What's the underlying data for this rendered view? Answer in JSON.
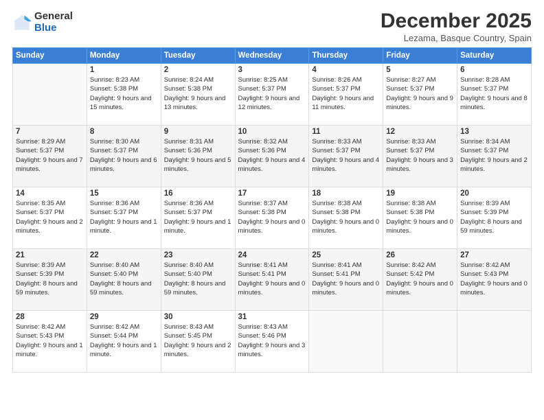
{
  "logo": {
    "general": "General",
    "blue": "Blue"
  },
  "title": "December 2025",
  "location": "Lezama, Basque Country, Spain",
  "weekdays": [
    "Sunday",
    "Monday",
    "Tuesday",
    "Wednesday",
    "Thursday",
    "Friday",
    "Saturday"
  ],
  "weeks": [
    [
      {
        "day": null,
        "sunrise": null,
        "sunset": null,
        "daylight": null
      },
      {
        "day": "1",
        "sunrise": "Sunrise: 8:23 AM",
        "sunset": "Sunset: 5:38 PM",
        "daylight": "Daylight: 9 hours and 15 minutes."
      },
      {
        "day": "2",
        "sunrise": "Sunrise: 8:24 AM",
        "sunset": "Sunset: 5:38 PM",
        "daylight": "Daylight: 9 hours and 13 minutes."
      },
      {
        "day": "3",
        "sunrise": "Sunrise: 8:25 AM",
        "sunset": "Sunset: 5:37 PM",
        "daylight": "Daylight: 9 hours and 12 minutes."
      },
      {
        "day": "4",
        "sunrise": "Sunrise: 8:26 AM",
        "sunset": "Sunset: 5:37 PM",
        "daylight": "Daylight: 9 hours and 11 minutes."
      },
      {
        "day": "5",
        "sunrise": "Sunrise: 8:27 AM",
        "sunset": "Sunset: 5:37 PM",
        "daylight": "Daylight: 9 hours and 9 minutes."
      },
      {
        "day": "6",
        "sunrise": "Sunrise: 8:28 AM",
        "sunset": "Sunset: 5:37 PM",
        "daylight": "Daylight: 9 hours and 8 minutes."
      }
    ],
    [
      {
        "day": "7",
        "sunrise": "Sunrise: 8:29 AM",
        "sunset": "Sunset: 5:37 PM",
        "daylight": "Daylight: 9 hours and 7 minutes."
      },
      {
        "day": "8",
        "sunrise": "Sunrise: 8:30 AM",
        "sunset": "Sunset: 5:37 PM",
        "daylight": "Daylight: 9 hours and 6 minutes."
      },
      {
        "day": "9",
        "sunrise": "Sunrise: 8:31 AM",
        "sunset": "Sunset: 5:36 PM",
        "daylight": "Daylight: 9 hours and 5 minutes."
      },
      {
        "day": "10",
        "sunrise": "Sunrise: 8:32 AM",
        "sunset": "Sunset: 5:36 PM",
        "daylight": "Daylight: 9 hours and 4 minutes."
      },
      {
        "day": "11",
        "sunrise": "Sunrise: 8:33 AM",
        "sunset": "Sunset: 5:37 PM",
        "daylight": "Daylight: 9 hours and 4 minutes."
      },
      {
        "day": "12",
        "sunrise": "Sunrise: 8:33 AM",
        "sunset": "Sunset: 5:37 PM",
        "daylight": "Daylight: 9 hours and 3 minutes."
      },
      {
        "day": "13",
        "sunrise": "Sunrise: 8:34 AM",
        "sunset": "Sunset: 5:37 PM",
        "daylight": "Daylight: 9 hours and 2 minutes."
      }
    ],
    [
      {
        "day": "14",
        "sunrise": "Sunrise: 8:35 AM",
        "sunset": "Sunset: 5:37 PM",
        "daylight": "Daylight: 9 hours and 2 minutes."
      },
      {
        "day": "15",
        "sunrise": "Sunrise: 8:36 AM",
        "sunset": "Sunset: 5:37 PM",
        "daylight": "Daylight: 9 hours and 1 minute."
      },
      {
        "day": "16",
        "sunrise": "Sunrise: 8:36 AM",
        "sunset": "Sunset: 5:37 PM",
        "daylight": "Daylight: 9 hours and 1 minute."
      },
      {
        "day": "17",
        "sunrise": "Sunrise: 8:37 AM",
        "sunset": "Sunset: 5:38 PM",
        "daylight": "Daylight: 9 hours and 0 minutes."
      },
      {
        "day": "18",
        "sunrise": "Sunrise: 8:38 AM",
        "sunset": "Sunset: 5:38 PM",
        "daylight": "Daylight: 9 hours and 0 minutes."
      },
      {
        "day": "19",
        "sunrise": "Sunrise: 8:38 AM",
        "sunset": "Sunset: 5:38 PM",
        "daylight": "Daylight: 9 hours and 0 minutes."
      },
      {
        "day": "20",
        "sunrise": "Sunrise: 8:39 AM",
        "sunset": "Sunset: 5:39 PM",
        "daylight": "Daylight: 8 hours and 59 minutes."
      }
    ],
    [
      {
        "day": "21",
        "sunrise": "Sunrise: 8:39 AM",
        "sunset": "Sunset: 5:39 PM",
        "daylight": "Daylight: 8 hours and 59 minutes."
      },
      {
        "day": "22",
        "sunrise": "Sunrise: 8:40 AM",
        "sunset": "Sunset: 5:40 PM",
        "daylight": "Daylight: 8 hours and 59 minutes."
      },
      {
        "day": "23",
        "sunrise": "Sunrise: 8:40 AM",
        "sunset": "Sunset: 5:40 PM",
        "daylight": "Daylight: 8 hours and 59 minutes."
      },
      {
        "day": "24",
        "sunrise": "Sunrise: 8:41 AM",
        "sunset": "Sunset: 5:41 PM",
        "daylight": "Daylight: 9 hours and 0 minutes."
      },
      {
        "day": "25",
        "sunrise": "Sunrise: 8:41 AM",
        "sunset": "Sunset: 5:41 PM",
        "daylight": "Daylight: 9 hours and 0 minutes."
      },
      {
        "day": "26",
        "sunrise": "Sunrise: 8:42 AM",
        "sunset": "Sunset: 5:42 PM",
        "daylight": "Daylight: 9 hours and 0 minutes."
      },
      {
        "day": "27",
        "sunrise": "Sunrise: 8:42 AM",
        "sunset": "Sunset: 5:43 PM",
        "daylight": "Daylight: 9 hours and 0 minutes."
      }
    ],
    [
      {
        "day": "28",
        "sunrise": "Sunrise: 8:42 AM",
        "sunset": "Sunset: 5:43 PM",
        "daylight": "Daylight: 9 hours and 1 minute."
      },
      {
        "day": "29",
        "sunrise": "Sunrise: 8:42 AM",
        "sunset": "Sunset: 5:44 PM",
        "daylight": "Daylight: 9 hours and 1 minute."
      },
      {
        "day": "30",
        "sunrise": "Sunrise: 8:43 AM",
        "sunset": "Sunset: 5:45 PM",
        "daylight": "Daylight: 9 hours and 2 minutes."
      },
      {
        "day": "31",
        "sunrise": "Sunrise: 8:43 AM",
        "sunset": "Sunset: 5:46 PM",
        "daylight": "Daylight: 9 hours and 3 minutes."
      },
      {
        "day": null,
        "sunrise": null,
        "sunset": null,
        "daylight": null
      },
      {
        "day": null,
        "sunrise": null,
        "sunset": null,
        "daylight": null
      },
      {
        "day": null,
        "sunrise": null,
        "sunset": null,
        "daylight": null
      }
    ]
  ]
}
